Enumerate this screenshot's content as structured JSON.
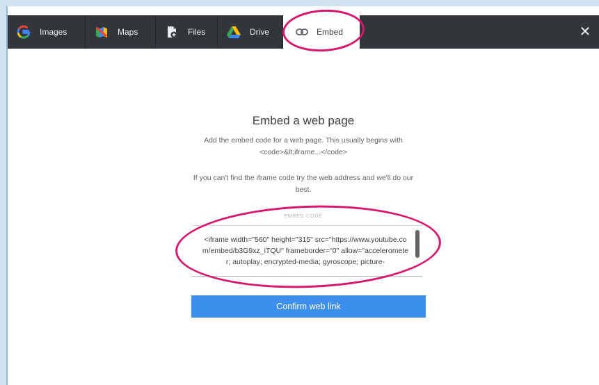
{
  "tabs": [
    {
      "label": "Images",
      "icon": "google-g-icon"
    },
    {
      "label": "Maps",
      "icon": "maps-icon"
    },
    {
      "label": "Files",
      "icon": "file-upload-icon"
    },
    {
      "label": "Drive",
      "icon": "drive-icon"
    },
    {
      "label": "Embed",
      "icon": "link-icon",
      "active": true
    }
  ],
  "close_label": "✕",
  "embed": {
    "title": "Embed a web page",
    "description_1": "Add the embed code for a web page. This usually begins with <code>&lt;iframe...</code>",
    "description_2": "If you can't find the iframe code try the web address and we'll do our best.",
    "field_label": "EMBED CODE",
    "code_value": "<iframe width=\"560\" height=\"315\" src=\"https://www.youtube.com/embed/b3G9xz_iTQU\" frameborder=\"0\" allow=\"accelerometer; autoplay; encrypted-media; gyroscope; picture-",
    "confirm_label": "Confirm web link"
  },
  "colors": {
    "tab_bar": "#32363a",
    "accent_button": "#3d8fee",
    "annotation": "#d6186e"
  }
}
